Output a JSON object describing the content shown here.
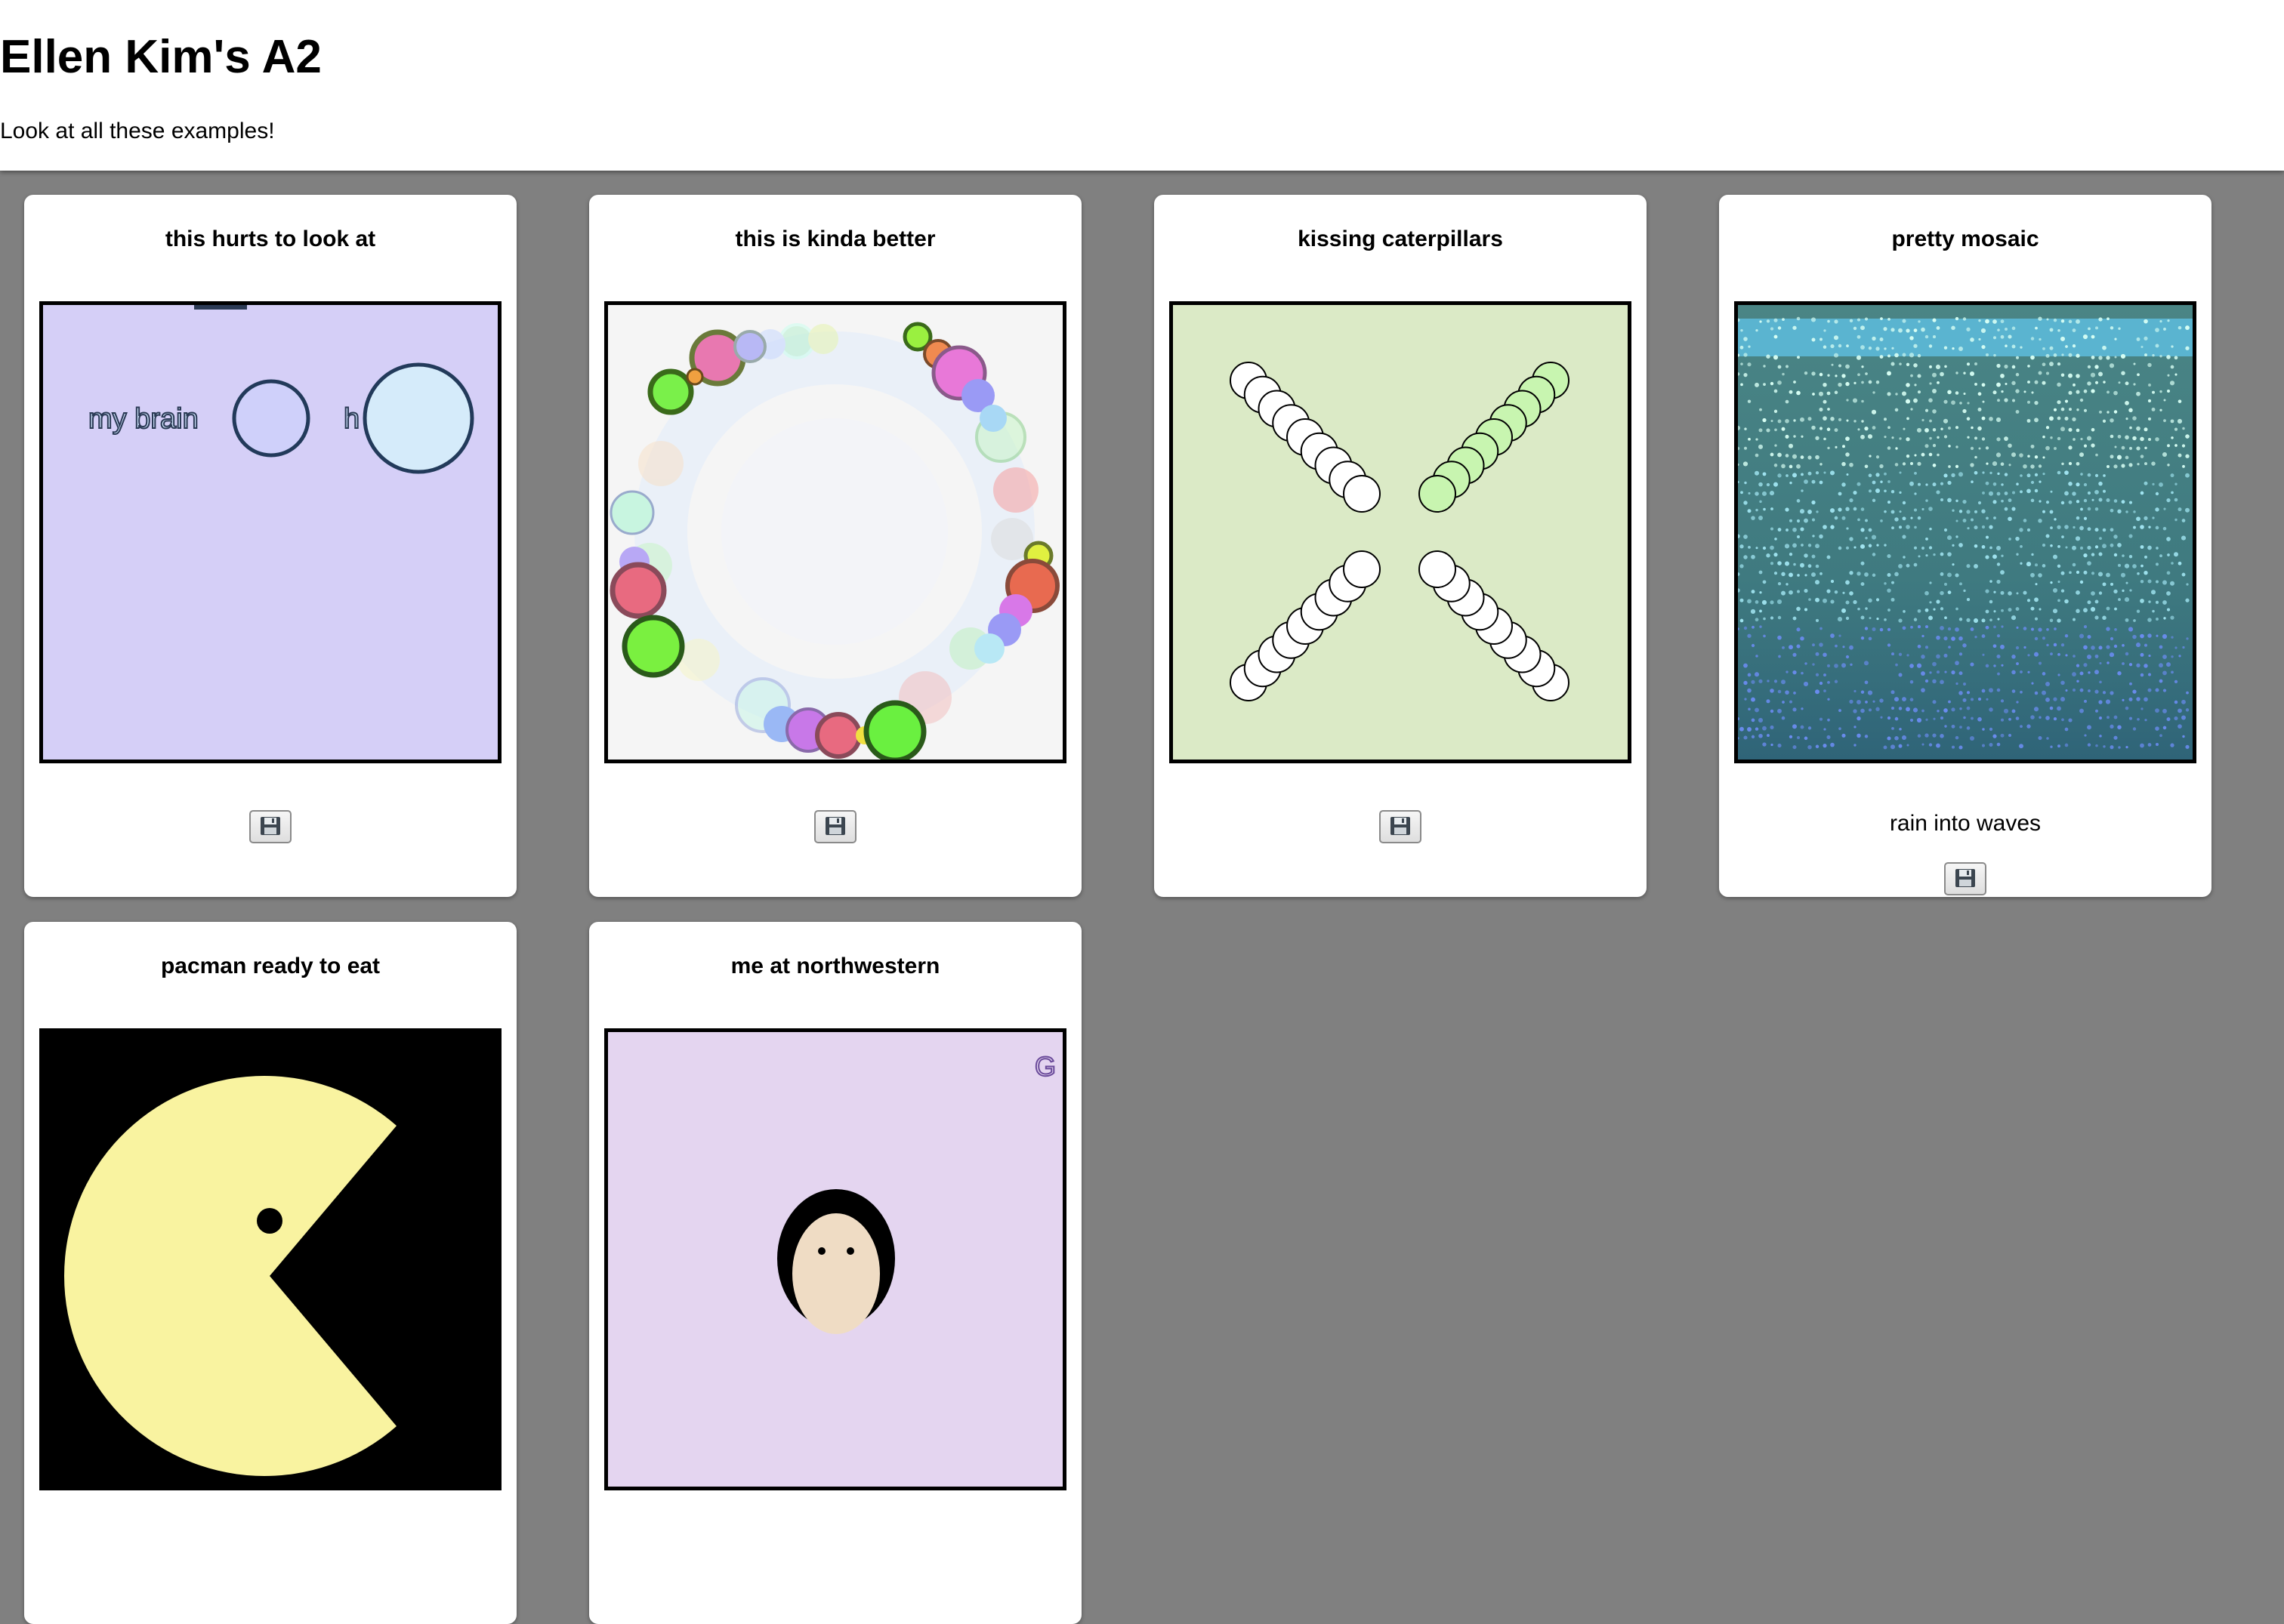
{
  "header": {
    "title": "Ellen Kim's A2",
    "subtitle": "Look at all these examples!"
  },
  "cards": [
    {
      "title": "this hurts to look at",
      "canvas_labels": [
        "my brain",
        "h"
      ],
      "save_icon": "floppy-disk-icon",
      "background": "#d5cff7"
    },
    {
      "title": "this is kinda better",
      "save_icon": "floppy-disk-icon",
      "background": "#f5f5f5"
    },
    {
      "title": "kissing caterpillars",
      "save_icon": "floppy-disk-icon",
      "background": "#dbeac6"
    },
    {
      "title": "pretty mosaic",
      "caption": "rain into waves",
      "save_icon": "floppy-disk-icon",
      "background": "#4a8080"
    },
    {
      "title": "pacman ready to eat",
      "background": "#000000",
      "accent": "#f9f3a0"
    },
    {
      "title": "me at northwestern",
      "canvas_labels": [
        "G"
      ],
      "background": "#e4d5f0"
    }
  ],
  "colors": {
    "page_background": "#808080",
    "card_background": "#ffffff"
  }
}
